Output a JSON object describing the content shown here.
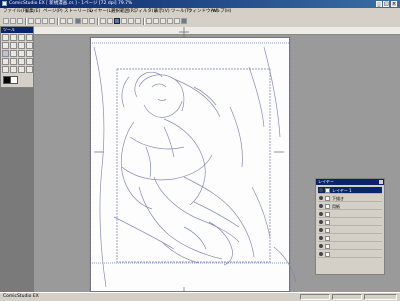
{
  "app": {
    "title": "ComicStudio EX [ 新規漫画.cs ] - 1ページ [72 dpi] 79.7%",
    "status": "ComicStudio EX"
  },
  "menu": [
    "ファイル(F)",
    "編集(E)",
    "ページ(P)",
    "ストーリー(S)",
    "レイヤー(L)",
    "選択範囲(R)",
    "フィルタ(I)",
    "表示(V)",
    "ツール(T)",
    "ウィンドウ(W)",
    "ヘルプ(H)"
  ],
  "layers": {
    "items": [
      {
        "name": "レイヤー 1",
        "selected": true
      },
      {
        "name": "下描き",
        "selected": false
      },
      {
        "name": "用紙",
        "selected": false
      },
      {
        "name": "",
        "selected": false
      },
      {
        "name": "",
        "selected": false
      },
      {
        "name": "",
        "selected": false
      },
      {
        "name": "",
        "selected": false
      },
      {
        "name": "",
        "selected": false
      },
      {
        "name": "",
        "selected": false
      }
    ]
  },
  "colors": {
    "accent": "#0a246a",
    "sketch": "#7b7fb0"
  }
}
